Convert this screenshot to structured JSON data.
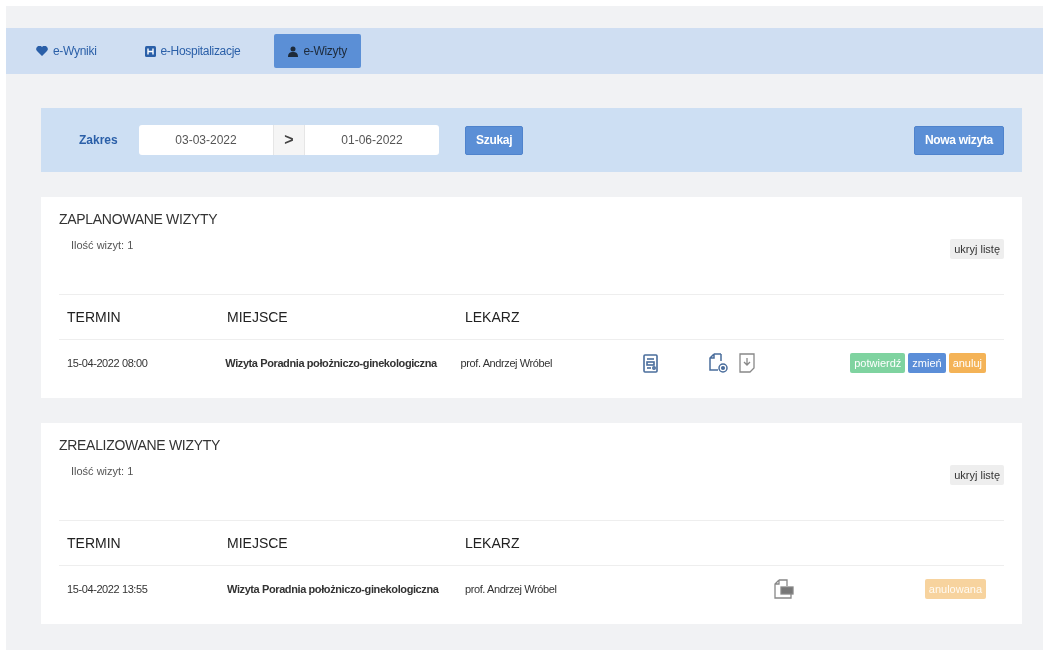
{
  "tabs": [
    {
      "label": "e-Wyniki",
      "kind": "heart",
      "selected": false
    },
    {
      "label": "e-Hospitalizacje",
      "kind": "hospital",
      "selected": false
    },
    {
      "label": "e-Wizyty",
      "kind": "doctor",
      "selected": true
    }
  ],
  "filter": {
    "label": "Zakres",
    "date_from": "03-03-2022",
    "separator": ">",
    "date_to": "01-06-2022",
    "search_button": "Szukaj",
    "new_button": "Nowa wizyta"
  },
  "sections": [
    {
      "title": "ZAPLANOWANE WIZYTY",
      "count": "Ilość wizyt: 1",
      "toggle": "ukryj listę",
      "columns": [
        "TERMIN",
        "MIEJSCE",
        "LEKARZ"
      ],
      "rows": [
        {
          "date": "15-04-2022 08:00",
          "place": "Wizyta Poradnia położniczo-ginekologiczna",
          "doctor": "prof. Andrzej Wróbel",
          "icons": [
            {
              "kind": "form"
            },
            {
              "kind": "document-gear"
            },
            {
              "kind": "download"
            }
          ],
          "badges": [
            {
              "label": "potwierdź",
              "color": "#7fd3a0",
              "disabled": false
            },
            {
              "label": "zmień",
              "color": "#5b8ed8",
              "disabled": false
            },
            {
              "label": "anuluj",
              "color": "#f4b357",
              "disabled": false
            }
          ]
        }
      ]
    },
    {
      "title": "ZREALIZOWANE WIZYTY",
      "count": "Ilość wizyt: 1",
      "toggle": "ukryj listę",
      "columns": [
        "TERMIN",
        "MIEJSCE",
        "LEKARZ"
      ],
      "rows": [
        {
          "date": "15-04-2022 13:55",
          "place": "Wizyta Poradnia położniczo-ginekologiczna",
          "doctor": "prof. Andrzej Wróbel",
          "icons": [
            {
              "kind": "printer-document"
            }
          ],
          "badges": [
            {
              "label": "anulowana",
              "color": "#f7d39e",
              "disabled": true
            }
          ]
        }
      ]
    }
  ]
}
